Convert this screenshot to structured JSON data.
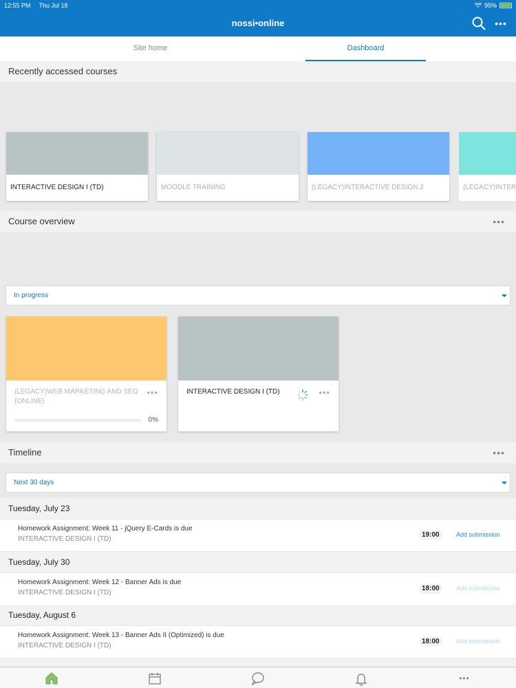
{
  "status": {
    "time": "12:55 PM",
    "date": "Thu Jul 18",
    "battery": "95%"
  },
  "app": {
    "title": "nossi•online"
  },
  "tabs": [
    {
      "label": "Site home",
      "active": false
    },
    {
      "label": "Dashboard",
      "active": true
    }
  ],
  "recent": {
    "heading": "Recently accessed courses",
    "courses": [
      {
        "name": "INTERACTIVE DESIGN I (TD)",
        "color": "#b8c3c6",
        "text_color": "#222"
      },
      {
        "name": "MOODLE TRAINING",
        "color": "#dee4e5",
        "text_color": "#b0b0b0"
      },
      {
        "name": "(LEGACY)INTERACTIVE DESIGN 2",
        "color": "#74b2f7",
        "text_color": "#b0b0b0"
      },
      {
        "name": "(LEGACY)INTER",
        "color": "#7de5de",
        "text_color": "#b0b0b0"
      }
    ]
  },
  "overview": {
    "heading": "Course overview",
    "filter": "In progress",
    "courses": [
      {
        "name": "(LEGACY)WEB MARKETING AND SEO (ONLINE)",
        "color": "#fec76e",
        "text_color": "#b5b5b5",
        "progress": "0%"
      },
      {
        "name": "INTERACTIVE DESIGN I (TD)",
        "color": "#b8c3c6",
        "text_color": "#222"
      }
    ]
  },
  "timeline": {
    "heading": "Timeline",
    "filter": "Next 30 days",
    "days": [
      {
        "date": "Tuesday, July 23",
        "event": {
          "title": "Homework Assignment: Week 11 - jQuery E-Cards is due",
          "course": "INTERACTIVE DESIGN I (TD)",
          "time": "19:00",
          "action": "Add submission",
          "action_color": "#1f88d4"
        }
      },
      {
        "date": "Tuesday, July 30",
        "event": {
          "title": "Homework Assignment: Week 12 - Banner Ads is due",
          "course": "INTERACTIVE DESIGN I (TD)",
          "time": "18:00",
          "action": "Add submission",
          "action_color": "#b7d6ee"
        }
      },
      {
        "date": "Tuesday, August 6",
        "event": {
          "title": "Homework Assignment: Week 13 - Banner Ads II (Optimized) is due",
          "course": "INTERACTIVE DESIGN I (TD)",
          "time": "18:00",
          "action": "Add submission",
          "action_color": "#b7d6ee"
        }
      }
    ]
  },
  "bottom_nav": [
    {
      "icon": "home-icon",
      "color": "#9ccf7a"
    },
    {
      "icon": "calendar-icon",
      "color": "#ffffff"
    },
    {
      "icon": "messages-icon",
      "color": "#ffffff"
    },
    {
      "icon": "bell-icon",
      "color": "#ffffff"
    },
    {
      "icon": "more-icon",
      "color": "#ffffff"
    }
  ]
}
